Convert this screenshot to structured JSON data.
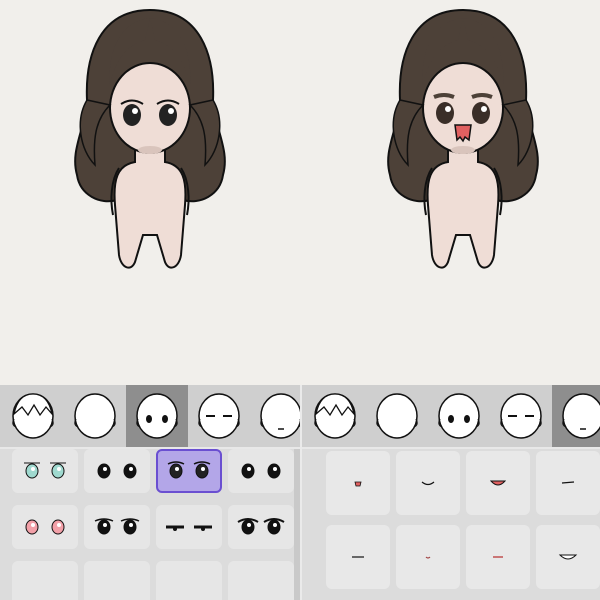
{
  "colors": {
    "background": "#f1efeb",
    "hair": "#4d4138",
    "skin": "#efddd6",
    "outline": "#111111",
    "selected_tab": "#8e8e8e",
    "selected_cell_fill": "#b3a6e8",
    "selected_cell_border": "#6a4fd1",
    "mouth_red": "#e06060"
  },
  "left_panel": {
    "head_tabs": [
      "hair-bangs-head-icon",
      "bald-head-icon",
      "eyes-head-icon",
      "closed-eyes-head-icon",
      "mouth-head-icon"
    ],
    "selected_head_tab": 2,
    "eye_options": [
      "teal-eyes-icon",
      "small-dark-eyes-icon",
      "wide-eyes-icon",
      "round-eyes-icon",
      "pink-eyes-icon",
      "oval-eyes-icon",
      "flat-eyes-icon",
      "big-eyes-icon",
      "blank-option",
      "blank-option",
      "blank-option",
      "blank-option"
    ],
    "selected_eye_option": 2
  },
  "right_panel": {
    "head_tabs": [
      "hair-bangs-head-icon",
      "bald-head-icon",
      "eyes-head-icon",
      "closed-eyes-head-icon",
      "mouth-head-icon"
    ],
    "selected_head_tab": 4,
    "mouth_options": [
      "small-red-mouth-icon",
      "smile-mouth-icon",
      "open-smile-mouth-icon",
      "line-mouth-icon",
      "flat-mouth-icon",
      "dot-mouth-icon",
      "lip-mouth-icon",
      "grin-mouth-icon"
    ]
  }
}
